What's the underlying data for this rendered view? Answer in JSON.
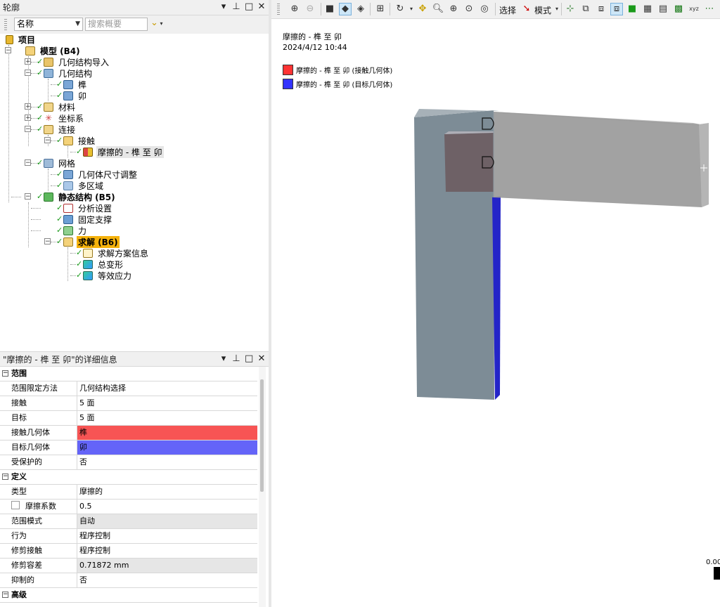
{
  "outline": {
    "title": "轮廓",
    "controls": {
      "dropdown": "▾",
      "pin": "⊥",
      "maximize": "□",
      "close": "✕"
    },
    "filter": {
      "field": "名称",
      "search_placeholder": "搜索概要",
      "go": "⌄"
    },
    "tree": [
      {
        "id": "project",
        "label": "项目",
        "bold": true
      },
      {
        "id": "model",
        "label": "模型 (B4)",
        "bold": true
      },
      {
        "id": "geom-import",
        "label": "几何结构导入"
      },
      {
        "id": "geometry",
        "label": "几何结构"
      },
      {
        "id": "tenon",
        "label": "榫"
      },
      {
        "id": "mortise",
        "label": "卯"
      },
      {
        "id": "materials",
        "label": "材料"
      },
      {
        "id": "coords",
        "label": "坐标系"
      },
      {
        "id": "connections",
        "label": "连接"
      },
      {
        "id": "contacts",
        "label": "接触"
      },
      {
        "id": "friction",
        "label": "摩擦的 - 榫 至 卯"
      },
      {
        "id": "mesh",
        "label": "网格"
      },
      {
        "id": "sizing",
        "label": "几何体尺寸调整"
      },
      {
        "id": "multizone",
        "label": "多区域"
      },
      {
        "id": "static",
        "label": "静态结构 (B5)",
        "bold": true
      },
      {
        "id": "analysis",
        "label": "分析设置"
      },
      {
        "id": "fixed",
        "label": "固定支撑"
      },
      {
        "id": "force",
        "label": "力"
      },
      {
        "id": "solution",
        "label": "求解 (B6)",
        "bold": true
      },
      {
        "id": "sol-info",
        "label": "求解方案信息"
      },
      {
        "id": "total-def",
        "label": "总变形"
      },
      {
        "id": "eq-stress",
        "label": "等效应力"
      }
    ]
  },
  "details": {
    "title": "\"摩擦的 - 榫 至 卯\"的详细信息",
    "rows": [
      {
        "section": true,
        "k": "范围"
      },
      {
        "k": "范围限定方法",
        "v": "几何结构选择"
      },
      {
        "k": "接触",
        "v": "5 面"
      },
      {
        "k": "目标",
        "v": "5 面"
      },
      {
        "k": "接触几何体",
        "v": "榫",
        "bg": "#f75454"
      },
      {
        "k": "目标几何体",
        "v": "卯",
        "bg": "#6464f8"
      },
      {
        "k": "受保护的",
        "v": "否"
      },
      {
        "section": true,
        "k": "定义"
      },
      {
        "k": "类型",
        "v": "摩擦的"
      },
      {
        "k": "摩擦系数",
        "v": "0.5",
        "checkbox": true
      },
      {
        "k": "范围模式",
        "v": "自动",
        "gray": true
      },
      {
        "k": "行为",
        "v": "程序控制"
      },
      {
        "k": "修剪接触",
        "v": "程序控制"
      },
      {
        "k": "修剪容差",
        "v": "0.71872 mm",
        "gray": true
      },
      {
        "k": "抑制的",
        "v": "否"
      },
      {
        "section": true,
        "k": "高级"
      }
    ]
  },
  "toolbar": {
    "select": "选择",
    "mode": "模式"
  },
  "viewport": {
    "title": "摩擦的 - 榫 至 卯",
    "datetime": "2024/4/12 10:44",
    "legend": [
      {
        "color": "#ff3333",
        "label": "摩擦的 - 榫 至 卯 (接触几何体)"
      },
      {
        "color": "#3333ff",
        "label": "摩擦的 - 榫 至 卯 (目标几何体)"
      }
    ],
    "scale_label": "0.00"
  }
}
